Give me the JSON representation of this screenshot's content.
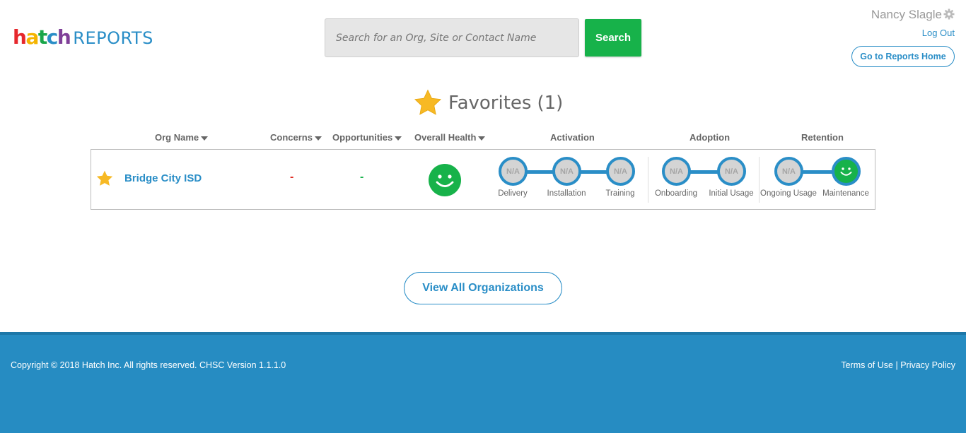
{
  "header": {
    "logo": {
      "letters": [
        "h",
        "a",
        "t",
        "c",
        "h"
      ],
      "colors": [
        "#e6272c",
        "#f4b400",
        "#1aa64a",
        "#2a8ec7",
        "#7f3f98"
      ],
      "suffix": "REPORTS"
    },
    "search": {
      "placeholder": "Search for an Org, Site or Contact Name",
      "button_label": "Search"
    },
    "user": {
      "name": "Nancy Slagle",
      "logout_label": "Log Out",
      "reports_home_label": "Go to Reports Home"
    }
  },
  "favorites": {
    "title": "Favorites",
    "count": "(1)",
    "columns": {
      "org_name": "Org Name",
      "concerns": "Concerns",
      "opportunities": "Opportunities",
      "overall_health": "Overall Health",
      "activation": "Activation",
      "adoption": "Adoption",
      "retention": "Retention"
    },
    "rows": [
      {
        "org_name": "Bridge City ISD",
        "concerns": "-",
        "opportunities": "-",
        "overall_health": "happy",
        "stages": [
          {
            "label": "Delivery",
            "status": "N/A"
          },
          {
            "label": "Installation",
            "status": "N/A"
          },
          {
            "label": "Training",
            "status": "N/A"
          },
          {
            "label": "Onboarding",
            "status": "N/A"
          },
          {
            "label": "Initial Usage",
            "status": "N/A"
          },
          {
            "label": "Ongoing Usage",
            "status": "N/A"
          },
          {
            "label": "Maintenance",
            "status": "happy"
          }
        ]
      }
    ]
  },
  "view_all_label": "View All Organizations",
  "footer": {
    "copyright": "Copyright © 2018 Hatch Inc. All rights reserved. CHSC Version 1.1.1.0",
    "terms": "Terms of Use",
    "separator": "|",
    "privacy": "Privacy Policy"
  },
  "colors": {
    "accent": "#2a8ec7",
    "success": "#17b24a",
    "star": "#f7b924",
    "concern": "#e0281f"
  },
  "icons": [
    "settings-gear-icon",
    "favorite-star-icon",
    "smiley-face-icon",
    "sort-caret-icon"
  ]
}
